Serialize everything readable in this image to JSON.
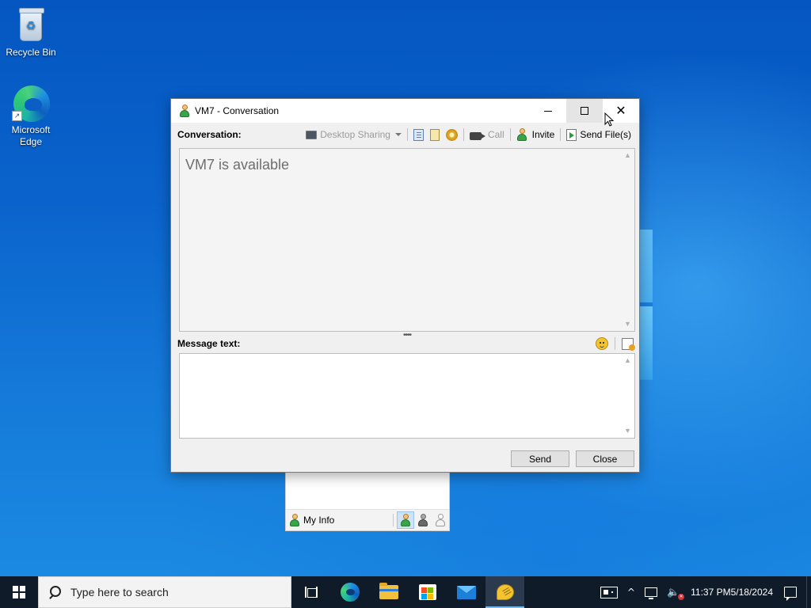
{
  "desktop": {
    "icons": [
      {
        "label": "Recycle Bin"
      },
      {
        "label": "Microsoft Edge"
      }
    ]
  },
  "conversation_window": {
    "title": "VM7 - Conversation",
    "conversation_label": "Conversation:",
    "toolbar": {
      "desktop_sharing": "Desktop Sharing",
      "call": "Call",
      "invite": "Invite",
      "send_files": "Send File(s)"
    },
    "status_message": "VM7 is available",
    "message_label": "Message text:",
    "message_value": "",
    "send_button": "Send",
    "close_button": "Close"
  },
  "contact_list": {
    "my_info": "My Info"
  },
  "taskbar": {
    "search_placeholder": "Type here to search",
    "time": "11:37 PM",
    "date": "5/18/2024"
  }
}
